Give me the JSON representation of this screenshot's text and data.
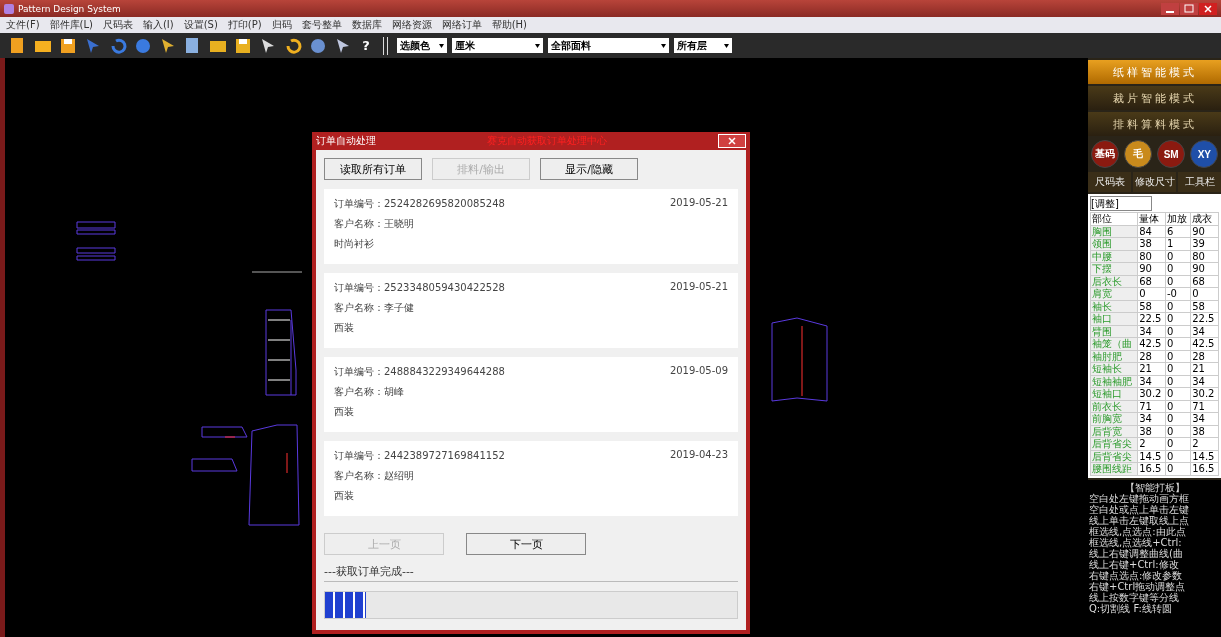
{
  "window": {
    "title": "Pattern Design System"
  },
  "menu": [
    "文件(F)",
    "部件库(L)",
    "尺码表",
    "输入(I)",
    "设置(S)",
    "打印(P)",
    "归码",
    "套号整单",
    "数据库",
    "网络资源",
    "网络订单",
    "帮助(H)"
  ],
  "toolbar": {
    "help": "?",
    "dropdowns": [
      "选颜色",
      "厘米",
      "全部面料",
      "所有层"
    ]
  },
  "dialog": {
    "title": "订单自动处理",
    "heading": "赛克自动获取订单处理中心",
    "buttons": [
      {
        "label": "读取所有订单",
        "disabled": false
      },
      {
        "label": "排料/输出",
        "disabled": true
      },
      {
        "label": "显示/隐藏",
        "disabled": false
      }
    ],
    "orders": [
      {
        "number_label": "订单编号：",
        "number": "2524282695820085248",
        "date": "2019-05-21",
        "customer_label": "客户名称：",
        "customer": "王晓明",
        "product": "时尚衬衫"
      },
      {
        "number_label": "订单编号：",
        "number": "2523348059430422528",
        "date": "2019-05-21",
        "customer_label": "客户名称：",
        "customer": "李子健",
        "product": "西装"
      },
      {
        "number_label": "订单编号：",
        "number": "2488843229349644288",
        "date": "2019-05-09",
        "customer_label": "客户名称：",
        "customer": "胡峰",
        "product": "西装"
      },
      {
        "number_label": "订单编号：",
        "number": "2442389727169841152",
        "date": "2019-04-23",
        "customer_label": "客户名称：",
        "customer": "赵绍明",
        "product": "西装"
      }
    ],
    "pager": [
      {
        "label": "上一页",
        "disabled": true
      },
      {
        "label": "下一页",
        "disabled": false
      }
    ],
    "status": "---获取订单完成---",
    "progress": {
      "level": 0.1
    }
  },
  "side": {
    "modes": [
      {
        "label": "纸样智能模式",
        "selected": true
      },
      {
        "label": "裁片智能模式",
        "selected": false
      },
      {
        "label": "排料算料模式",
        "selected": false
      }
    ],
    "circles": [
      {
        "label": "基码",
        "color": "#8b1a10"
      },
      {
        "label": "毛",
        "color": "#c98a1c"
      },
      {
        "label": "SM",
        "color": "#8b1a10"
      },
      {
        "label": "XY",
        "color": "#1f4fa8"
      }
    ],
    "tabs": [
      "尺码表",
      "修改尺寸",
      "工具栏"
    ],
    "size_select": "[调整]",
    "columns": [
      "部位",
      "量体",
      "加放",
      "成衣"
    ],
    "rows": [
      [
        "胸围",
        "84",
        "6",
        "90"
      ],
      [
        "领围",
        "38",
        "1",
        "39"
      ],
      [
        "中腰",
        "80",
        "0",
        "80"
      ],
      [
        "下摆",
        "90",
        "0",
        "90"
      ],
      [
        "后衣长",
        "68",
        "0",
        "68"
      ],
      [
        "肩宽",
        "0",
        "-0",
        "0"
      ],
      [
        "袖长",
        "58",
        "0",
        "58"
      ],
      [
        "袖口",
        "22.5",
        "0",
        "22.5"
      ],
      [
        "臂围",
        "34",
        "0",
        "34"
      ],
      [
        "袖笼（曲",
        "42.5",
        "0",
        "42.5"
      ],
      [
        "袖肘肥",
        "28",
        "0",
        "28"
      ],
      [
        "短袖长",
        "21",
        "0",
        "21"
      ],
      [
        "短袖袖肥",
        "34",
        "0",
        "34"
      ],
      [
        "短袖口",
        "30.2",
        "0",
        "30.2"
      ],
      [
        "前衣长",
        "71",
        "0",
        "71"
      ],
      [
        "前胸宽",
        "34",
        "0",
        "34"
      ],
      [
        "后背宽",
        "38",
        "0",
        "38"
      ],
      [
        "后背省尖",
        "2",
        "0",
        "2"
      ],
      [
        "后背省尖",
        "14.5",
        "0",
        "14.5"
      ],
      [
        "腰围线距",
        "16.5",
        "0",
        "16.5"
      ]
    ],
    "help_title": "【智能打板】",
    "help_lines": [
      "空白处左键拖动画方框",
      "空白处或点上单击左键",
      "线上单击左键取线上点",
      "框选线,点选点:由此点",
      "框选线,点选线+Ctrl:",
      "线上右键调整曲线(曲",
      "线上右键+Ctrl:修改",
      "右键点选点:修改参数",
      "右键+Ctrl拖动调整点",
      "线上按数字键等分线",
      "Q:切割线 F:线转圆"
    ]
  }
}
